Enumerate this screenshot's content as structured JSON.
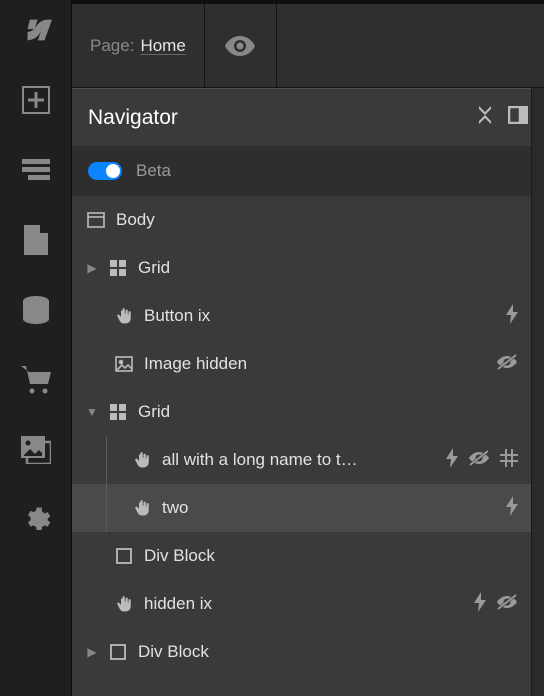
{
  "topbar": {
    "page_label": "Page:",
    "page_name": "Home"
  },
  "panel": {
    "title": "Navigator",
    "beta_label": "Beta"
  },
  "tree": {
    "root": {
      "label": "Body"
    },
    "n1": {
      "label": "Grid"
    },
    "n1a": {
      "label": "Button ix"
    },
    "n1b": {
      "label": "Image hidden"
    },
    "n2": {
      "label": "Grid"
    },
    "n2a": {
      "label": "all with a long name to t…"
    },
    "n2b": {
      "label": "two"
    },
    "n3": {
      "label": "Div Block"
    },
    "n4": {
      "label": "hidden ix"
    },
    "n5": {
      "label": "Div Block"
    }
  }
}
